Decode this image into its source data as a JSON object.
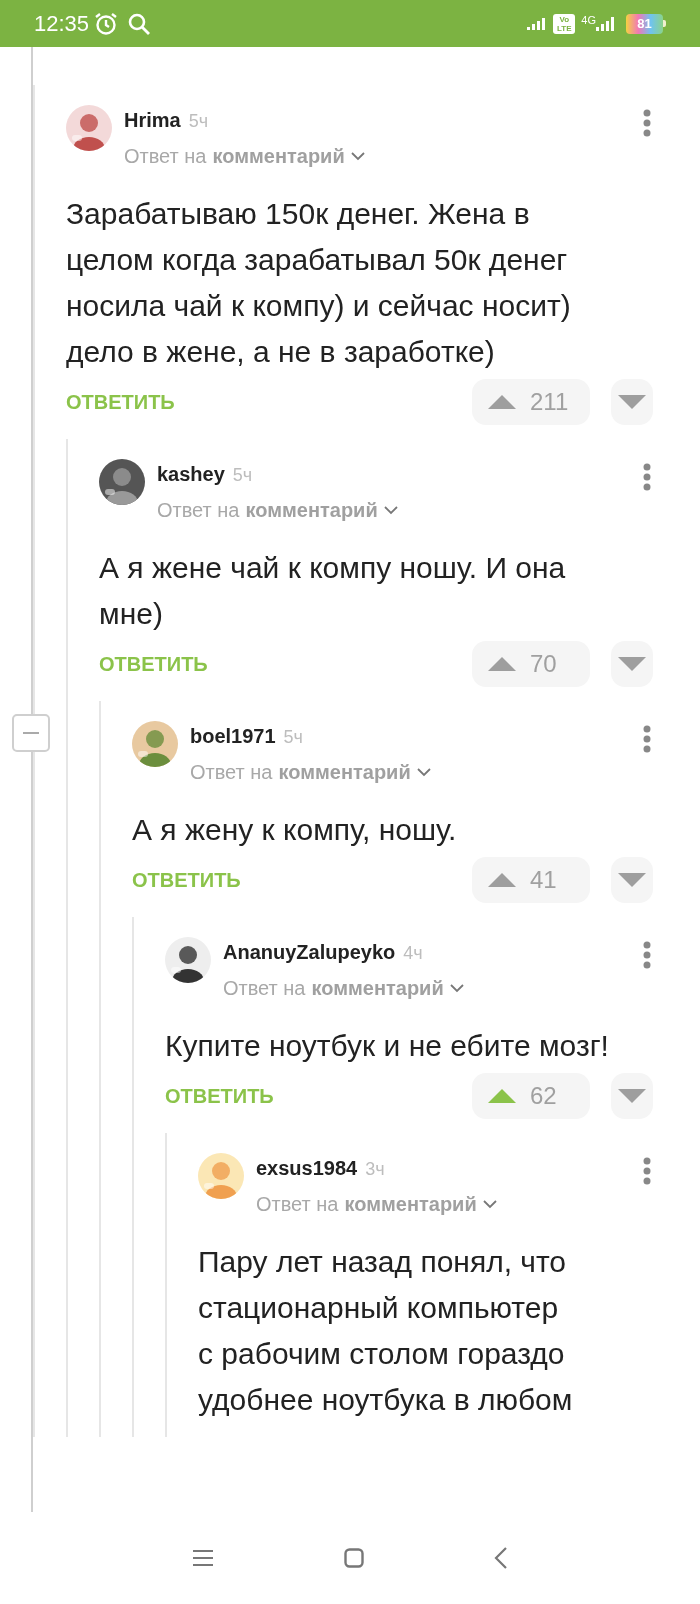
{
  "status_bar": {
    "time": "12:35",
    "volte": [
      "Vo",
      "LTE"
    ],
    "network": "4G",
    "battery": "81"
  },
  "comments": [
    {
      "author": "Hrima",
      "time": "5ч",
      "reply_prefix": "Ответ на",
      "reply_target": "комментарий",
      "text_lines": [
        "Зарабатываю 150к денег. Жена в",
        "целом когда зарабатывал 50к денег",
        "носила чай к компу) и сейчас носит)",
        "дело в жене, а не в заработке)"
      ],
      "reply_label": "ОТВЕТИТЬ",
      "votes": "211",
      "upvoted": false,
      "children": [
        {
          "author": "kashey",
          "time": "5ч",
          "reply_prefix": "Ответ на",
          "reply_target": "комментарий",
          "text_lines": [
            "А я жене чай к компу ношу. И она",
            "мне)"
          ],
          "reply_label": "ОТВЕТИТЬ",
          "votes": "70",
          "upvoted": false,
          "children": [
            {
              "author": "boel1971",
              "time": "5ч",
              "reply_prefix": "Ответ на",
              "reply_target": "комментарий",
              "text_lines": [
                "А я жену к компу, ношу."
              ],
              "reply_label": "ОТВЕТИТЬ",
              "votes": "41",
              "upvoted": false,
              "children": [
                {
                  "author": "AnanuyZalupeyko",
                  "time": "4ч",
                  "reply_prefix": "Ответ на",
                  "reply_target": "комментарий",
                  "text_lines": [
                    "Купите ноутбук и не ебите мозг!"
                  ],
                  "reply_label": "ОТВЕТИТЬ",
                  "votes": "62",
                  "upvoted": true,
                  "children": [
                    {
                      "author": "exsus1984",
                      "time": "3ч",
                      "reply_prefix": "Ответ на",
                      "reply_target": "комментарий",
                      "text_lines": [
                        "Пару лет назад понял, что",
                        "стационарный компьютер",
                        "с рабочим столом гораздо",
                        "удобнее ноутбука в любом"
                      ]
                    }
                  ]
                }
              ]
            }
          ]
        }
      ]
    }
  ]
}
